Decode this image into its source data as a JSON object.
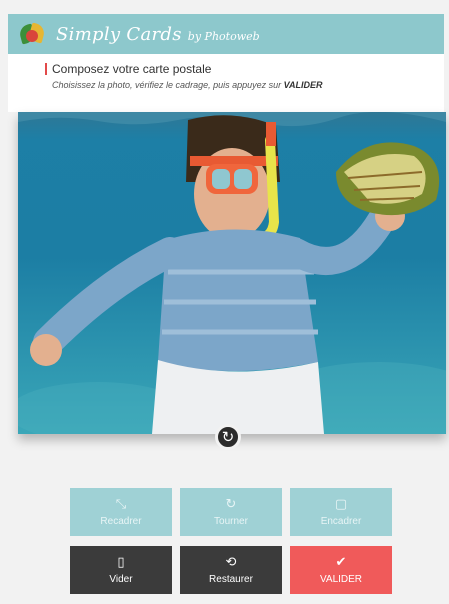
{
  "header": {
    "brand_name": "Simply Cards",
    "brand_by": "by Photoweb"
  },
  "intro": {
    "title": "Composez votre carte postale",
    "subtitle": "Choisissez la photo, vérifiez le cadrage, puis appuyez sur",
    "subtitle_action": "VALIDER"
  },
  "photo": {
    "description_icon": "photo-canvas"
  },
  "rotate": {
    "icon": "↻"
  },
  "actions": {
    "recadrer": {
      "icon": "⤡",
      "label": "Recadrer"
    },
    "tourner": {
      "icon": "↻",
      "label": "Tourner"
    },
    "encadrer": {
      "icon": "▢",
      "label": "Encadrer"
    },
    "vider": {
      "icon": "▯",
      "label": "Vider"
    },
    "restaurer": {
      "icon": "⟲",
      "label": "Restaurer"
    },
    "valider": {
      "icon": "✔",
      "label": "VALIDER"
    }
  },
  "colors": {
    "header": "#8dc8cc",
    "button_light": "#9fd1d5",
    "button_dark": "#3b3b3b",
    "button_valider": "#f05a5a",
    "accent_bar": "#e24a4a"
  }
}
